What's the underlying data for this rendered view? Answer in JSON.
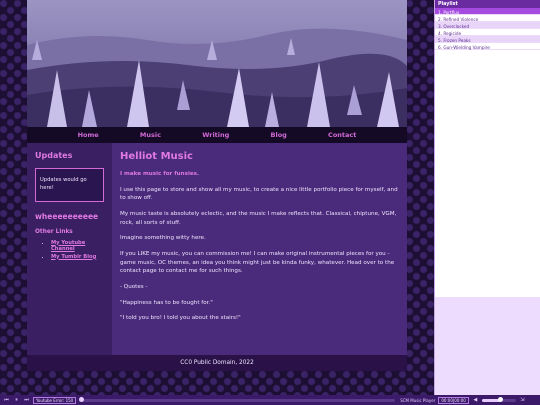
{
  "nav": [
    "Home",
    "Music",
    "Writing",
    "Blog",
    "Contact"
  ],
  "sidebar": {
    "updates_title": "Updates",
    "updates_text": "Updates would go here!",
    "whee": "wheeeeeeeeee",
    "other_links_title": "Other Links",
    "links": [
      "My Youtube Channel",
      "My Tumblr Blog"
    ]
  },
  "main": {
    "title": "Helliot Music",
    "paragraphs": [
      "I make music for funsies.",
      "I use this page to store and show all my music, to create a nice little portfolio piece for myself, and to show off.",
      "My music taste is absolutely eclectic, and the music I make reflects that. Classical, chiptune, VGM, rock, all sorts of stuff.",
      "Imagine something witty here.",
      "If you LIKE my music, you can commission me! I can make original instrumental pieces for you - game music, OC themes, an idea you think might just be kinda funky, whatever. Head over to the contact page to contact me for such things.",
      "- Quotes -",
      "\"Happiness has to be fought for.\"",
      "\"I told you bro! I told you about the stairs!\""
    ]
  },
  "footer": "CC0 Public Domain, 2022",
  "playlist": {
    "title": "Playlist",
    "tracks": [
      "1. Portflux",
      "2. Refined Violence",
      "3. Overclocked",
      "4. Regicide",
      "5. Frozen Peaks",
      "6. Gun-Wielding Vampire"
    ]
  },
  "player": {
    "status": "Youtube Error: 150",
    "name": "SCM Music Player",
    "time": "00:00|00:00",
    "progress": 0,
    "volume": 0.55
  },
  "colors": {
    "accent": "#e07ae2",
    "panel": "#4a2a7a",
    "sidebar": "#3a1f62",
    "active_track": "#a54be0"
  },
  "icons": [
    "prev-icon",
    "pause-icon",
    "next-icon",
    "stop-icon",
    "volume-icon",
    "expand-icon"
  ]
}
